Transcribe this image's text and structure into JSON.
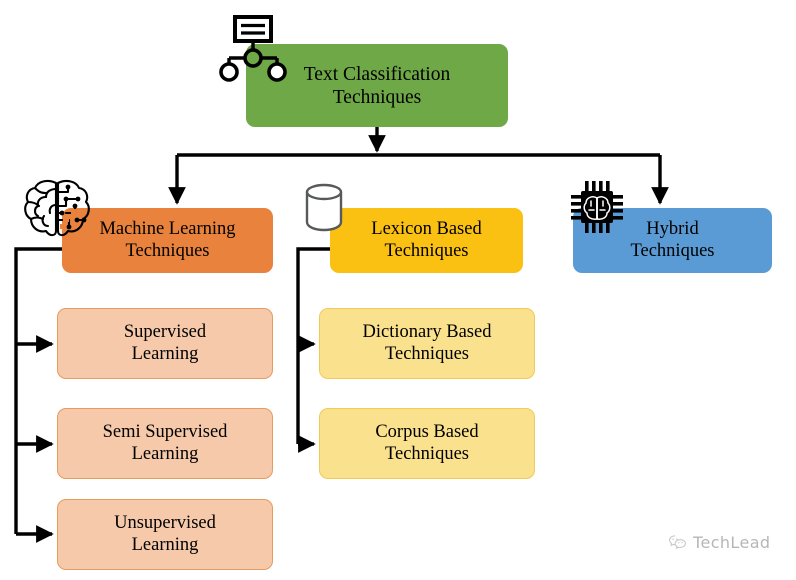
{
  "diagram": {
    "title": "Text Classification Techniques",
    "type": "hierarchy-tree",
    "root": {
      "label": "Text Classification\nTechniques",
      "color": "#6FA847",
      "icon": "org-chart-icon"
    },
    "branches": [
      {
        "id": "machine-learning",
        "label": "Machine Learning\nTechniques",
        "color": "#E8823C",
        "icon": "brain-circuit-icon",
        "children": [
          {
            "id": "supervised",
            "label": "Supervised\nLearning",
            "color": "#F5C9A9",
            "border": "#E79B5F"
          },
          {
            "id": "semi-supervised",
            "label": "Semi Supervised\nLearning",
            "color": "#F5C9A9",
            "border": "#E79B5F"
          },
          {
            "id": "unsupervised",
            "label": "Unsupervised\nLearning",
            "color": "#F5C9A9",
            "border": "#E79B5F"
          }
        ]
      },
      {
        "id": "lexicon-based",
        "label": "Lexicon Based\nTechniques",
        "color": "#FBC112",
        "icon": "database-cylinder-icon",
        "children": [
          {
            "id": "dictionary-based",
            "label": "Dictionary Based\nTechniques",
            "color": "#FAE18D",
            "border": "#F0CB5A"
          },
          {
            "id": "corpus-based",
            "label": "Corpus Based\nTechniques",
            "color": "#FAE18D",
            "border": "#F0CB5A"
          }
        ]
      },
      {
        "id": "hybrid",
        "label": "Hybrid\nTechniques",
        "color": "#5B9BD5",
        "icon": "ai-chip-brain-icon",
        "children": []
      }
    ]
  },
  "watermark": {
    "text": "TechLead",
    "icon": "wechat-logo-icon",
    "color": "#8a8a8a"
  },
  "colors": {
    "background": "#ffffff",
    "connector": "#000000",
    "text": "#000000"
  }
}
